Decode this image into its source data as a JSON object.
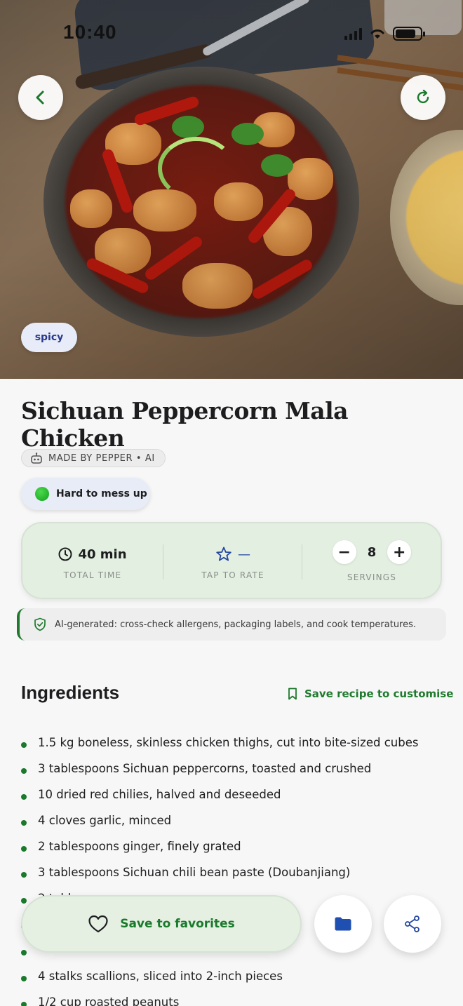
{
  "status_bar": {
    "time": "10:40"
  },
  "hero": {
    "tag": "spicy"
  },
  "recipe": {
    "title": "Sichuan Peppercorn Mala Chicken",
    "made_by": "MADE BY PEPPER • AI",
    "difficulty": "Hard to mess up"
  },
  "stats": {
    "time_value": "40 min",
    "time_label": "TOTAL TIME",
    "rating_value": "—",
    "rating_label": "TAP TO RATE",
    "servings_value": "8",
    "servings_label": "SERVINGS",
    "minus": "−",
    "plus": "+"
  },
  "warning": {
    "text": "AI-generated: cross-check allergens, packaging labels, and cook temperatures."
  },
  "ingredients": {
    "title": "Ingredients",
    "save_custom": "Save recipe to customise",
    "items": [
      "1.5 kg boneless, skinless chicken thighs, cut into bite-sized cubes",
      "3 tablespoons Sichuan peppercorns, toasted and crushed",
      "10 dried red chilies, halved and deseeded",
      "4 cloves garlic, minced",
      "2 tablespoons ginger, finely grated",
      "3 tablespoons Sichuan chili bean paste (Doubanjiang)",
      "2 tablespoons soy sauce",
      "",
      "",
      "4 stalks scallions, sliced into 2-inch pieces",
      "1/2 cup roasted peanuts"
    ]
  },
  "actions": {
    "save_favorites": "Save to favorites"
  },
  "colors": {
    "accent_green": "#1a7a2c",
    "stats_bg": "#e3efe1",
    "tag_text": "#2a3a8a",
    "rating_star": "#2346a0"
  }
}
